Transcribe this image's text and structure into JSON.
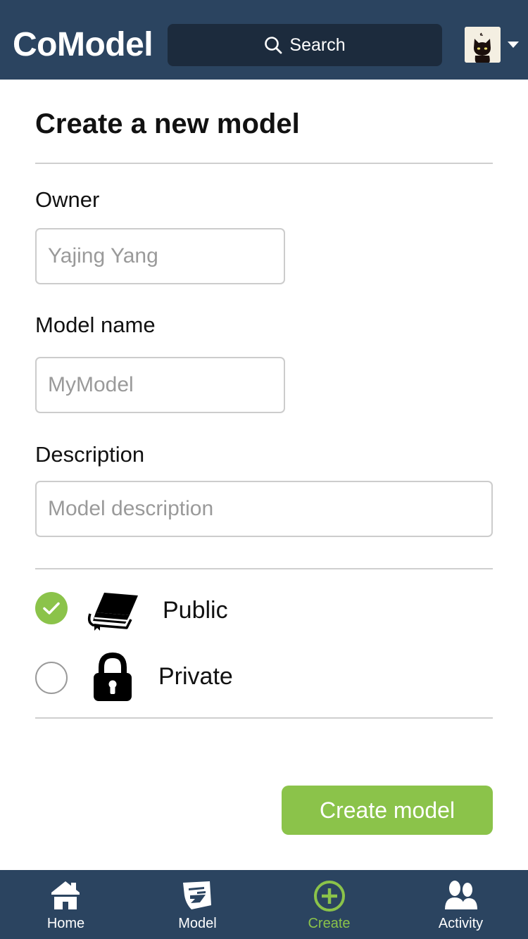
{
  "app": {
    "title": "CoModel"
  },
  "header": {
    "search_label": "Search",
    "search_icon": "search-icon",
    "avatar_icon": "cat-avatar",
    "menu_icon": "caret-down-icon"
  },
  "form": {
    "title": "Create a new model",
    "owner": {
      "label": "Owner",
      "placeholder": "Yajing Yang",
      "value": ""
    },
    "model_name": {
      "label": "Model name",
      "placeholder": "MyModel",
      "value": ""
    },
    "description": {
      "label": "Description",
      "placeholder": "Model description",
      "value": ""
    },
    "visibility": {
      "selected": "Public",
      "options": [
        {
          "label": "Public",
          "icon": "book-icon",
          "checked": true
        },
        {
          "label": "Private",
          "icon": "lock-icon",
          "checked": false
        }
      ]
    },
    "submit_label": "Create model"
  },
  "nav": {
    "tabs": [
      {
        "label": "Home",
        "icon": "home-icon",
        "active": false
      },
      {
        "label": "Model",
        "icon": "model-icon",
        "active": false
      },
      {
        "label": "Create",
        "icon": "plus-circle-icon",
        "active": true
      },
      {
        "label": "Activity",
        "icon": "people-icon",
        "active": false
      }
    ]
  },
  "colors": {
    "header_bg": "#2b4460",
    "search_bg": "#1c2b3d",
    "accent": "#8bc34a",
    "border": "#cccccc"
  }
}
